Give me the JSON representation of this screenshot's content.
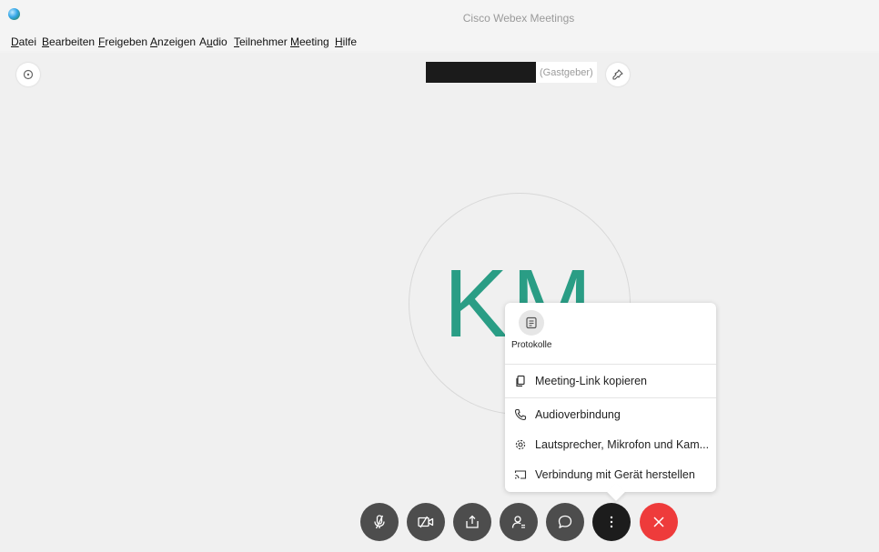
{
  "window": {
    "title": "Cisco Webex Meetings"
  },
  "menubar": {
    "items": [
      {
        "underline": "D",
        "rest": "atei"
      },
      {
        "underline": "B",
        "rest": "earbeiten"
      },
      {
        "underline": "F",
        "rest": "reigeben"
      },
      {
        "underline": "A",
        "rest": "nzeigen"
      },
      {
        "pre": "A",
        "underline": "u",
        "rest": "dio"
      },
      {
        "underline": "T",
        "rest": "eilnehmer"
      },
      {
        "underline": "M",
        "rest": "eeting"
      },
      {
        "underline": "H",
        "rest": "ilfe"
      }
    ]
  },
  "participant": {
    "role": "(Gastgeber)",
    "initials": "KM"
  },
  "more_menu": {
    "protocols_label": "Protokolle",
    "items": [
      {
        "label": "Meeting-Link kopieren",
        "icon": "copy-icon"
      },
      {
        "label": "Audioverbindung",
        "icon": "phone-icon"
      },
      {
        "label": "Lautsprecher, Mikrofon und Kam...",
        "icon": "settings-gear-icon"
      },
      {
        "label": "Verbindung mit Gerät herstellen",
        "icon": "cast-device-icon"
      }
    ]
  },
  "toolbar": {
    "buttons": [
      {
        "icon": "microphone-muted-icon"
      },
      {
        "icon": "video-off-icon"
      },
      {
        "icon": "share-icon"
      },
      {
        "icon": "participants-icon"
      },
      {
        "icon": "chat-icon"
      },
      {
        "icon": "more-options-icon"
      },
      {
        "icon": "leave-meeting-icon"
      }
    ]
  },
  "colors": {
    "avatar_text": "#2a9d85",
    "leave_button": "#ee3b3b",
    "toolbar_button": "#4d4d4d"
  }
}
